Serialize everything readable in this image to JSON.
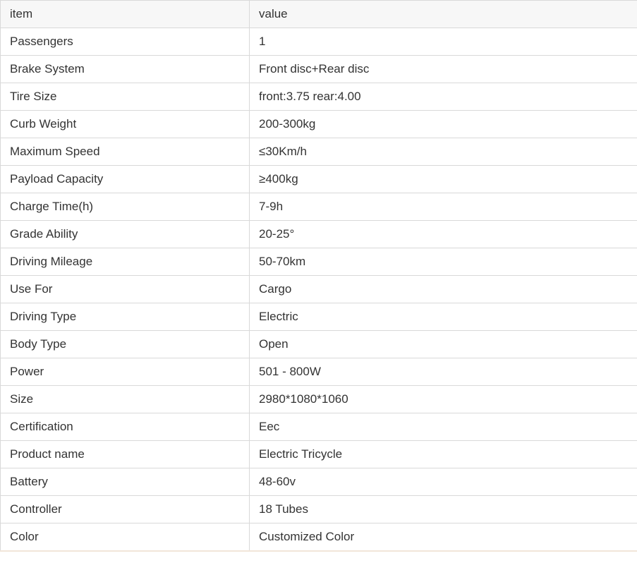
{
  "table": {
    "header": {
      "item": "item",
      "value": "value"
    },
    "rows": [
      {
        "item": "Passengers",
        "value": "1"
      },
      {
        "item": "Brake System",
        "value": "Front disc+Rear disc"
      },
      {
        "item": "Tire Size",
        "value": "front:3.75 rear:4.00"
      },
      {
        "item": "Curb Weight",
        "value": "200-300kg"
      },
      {
        "item": "Maximum Speed",
        "value": "≤30Km/h"
      },
      {
        "item": "Payload Capacity",
        "value": "≥400kg"
      },
      {
        "item": "Charge Time(h)",
        "value": "7-9h"
      },
      {
        "item": "Grade Ability",
        "value": "20-25°"
      },
      {
        "item": "Driving Mileage",
        "value": "50-70km"
      },
      {
        "item": "Use For",
        "value": "Cargo"
      },
      {
        "item": "Driving Type",
        "value": "Electric"
      },
      {
        "item": "Body Type",
        "value": "Open"
      },
      {
        "item": "Power",
        "value": "501 - 800W"
      },
      {
        "item": "Size",
        "value": "2980*1080*1060"
      },
      {
        "item": "Certification",
        "value": "Eec"
      },
      {
        "item": "Product name",
        "value": "Electric Tricycle"
      },
      {
        "item": "Battery",
        "value": "48-60v"
      },
      {
        "item": "Controller",
        "value": "18 Tubes"
      },
      {
        "item": "Color",
        "value": "Customized Color"
      }
    ]
  }
}
